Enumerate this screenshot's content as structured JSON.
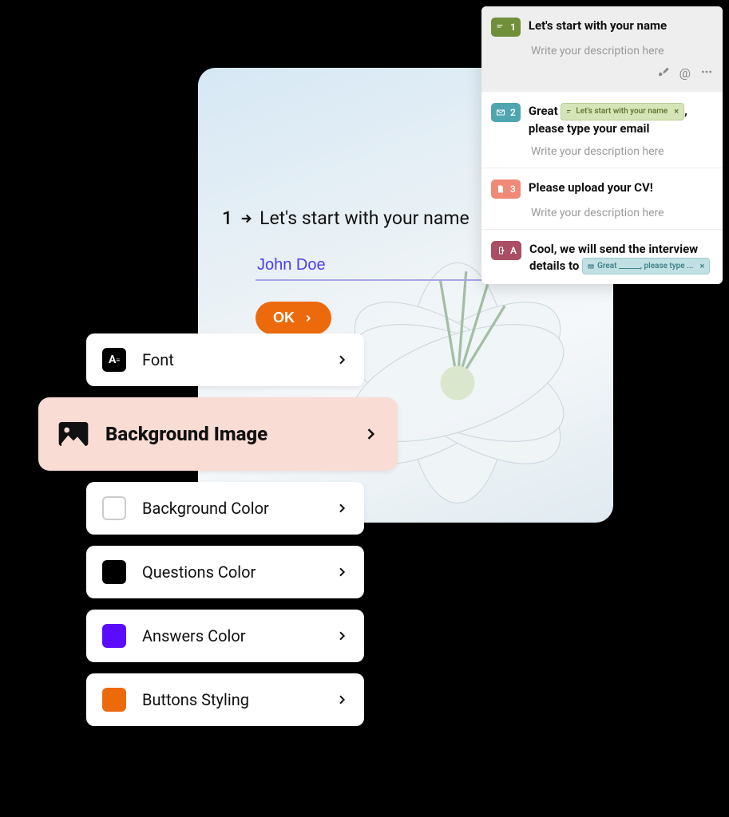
{
  "preview": {
    "question_number": "1",
    "question_text": "Let's start with your name",
    "answer_value": "John Doe",
    "ok_label": "OK"
  },
  "side_panel": {
    "steps": [
      {
        "badge_num": "1",
        "title": "Let's start with your name",
        "description": "Write your description here"
      },
      {
        "badge_num": "2",
        "title_pre": "Great",
        "chip_text": "Let's start with your name",
        "title_post": ", please type your email",
        "description": "Write your description here"
      },
      {
        "badge_num": "3",
        "title": "Please upload your CV!",
        "description": "Write your description here"
      },
      {
        "badge_num": "A",
        "title_pre": "Cool, we will send the interview details to",
        "chip_text": "Great ______, please type ..."
      }
    ],
    "toolbar_at": "@"
  },
  "settings": {
    "items": [
      {
        "label": "Font"
      },
      {
        "label": "Background Image"
      },
      {
        "label": "Background Color"
      },
      {
        "label": "Questions Color"
      },
      {
        "label": "Answers Color"
      },
      {
        "label": "Buttons Styling"
      }
    ],
    "font_glyph": "A",
    "colors": {
      "questions": "#000000",
      "answers": "#5a0cff",
      "buttons": "#ed6a0c"
    }
  }
}
